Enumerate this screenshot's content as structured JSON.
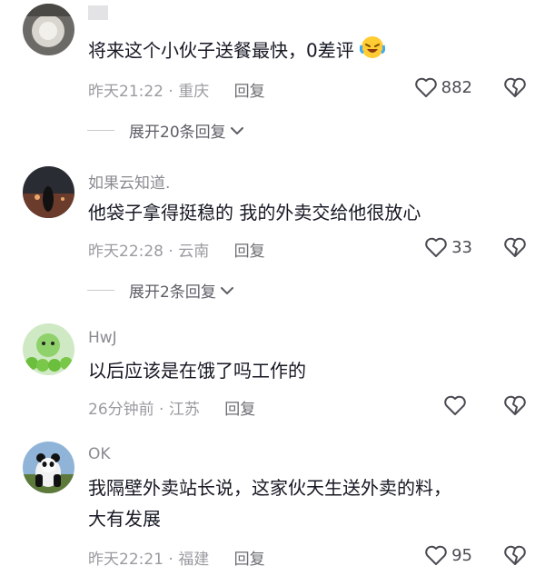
{
  "comments": [
    {
      "username": "",
      "text": "将来这个小伙子送餐最快，0差评",
      "time": "昨天21:22",
      "location": "重庆",
      "reply_label": "回复",
      "likes": "882",
      "expand_label": "展开20条回复"
    },
    {
      "username": "如果云知道.",
      "text": "他袋子拿得挺稳的 我的外卖交给他很放心",
      "time": "昨天22:28",
      "location": "云南",
      "reply_label": "回复",
      "likes": "33",
      "expand_label": "展开2条回复"
    },
    {
      "username": "HwJ",
      "text": "以后应该是在饿了吗工作的",
      "time": "26分钟前",
      "location": "江苏",
      "reply_label": "回复",
      "likes": ""
    },
    {
      "username": "OK",
      "text": "我隔壁外卖站长说，这家伙天生送外卖的料，",
      "text2": "大有发展",
      "time": "昨天22:21",
      "location": "福建",
      "reply_label": "回复",
      "likes": "95"
    }
  ],
  "icons": {
    "like": "heart-outline-icon",
    "dislike": "broken-heart-icon",
    "expand": "chevron-down-icon",
    "emoji": "laughing-crying-emoji"
  },
  "colors": {
    "text": "#161823",
    "meta": "#9a9ba0",
    "icon": "#4a4b52"
  }
}
